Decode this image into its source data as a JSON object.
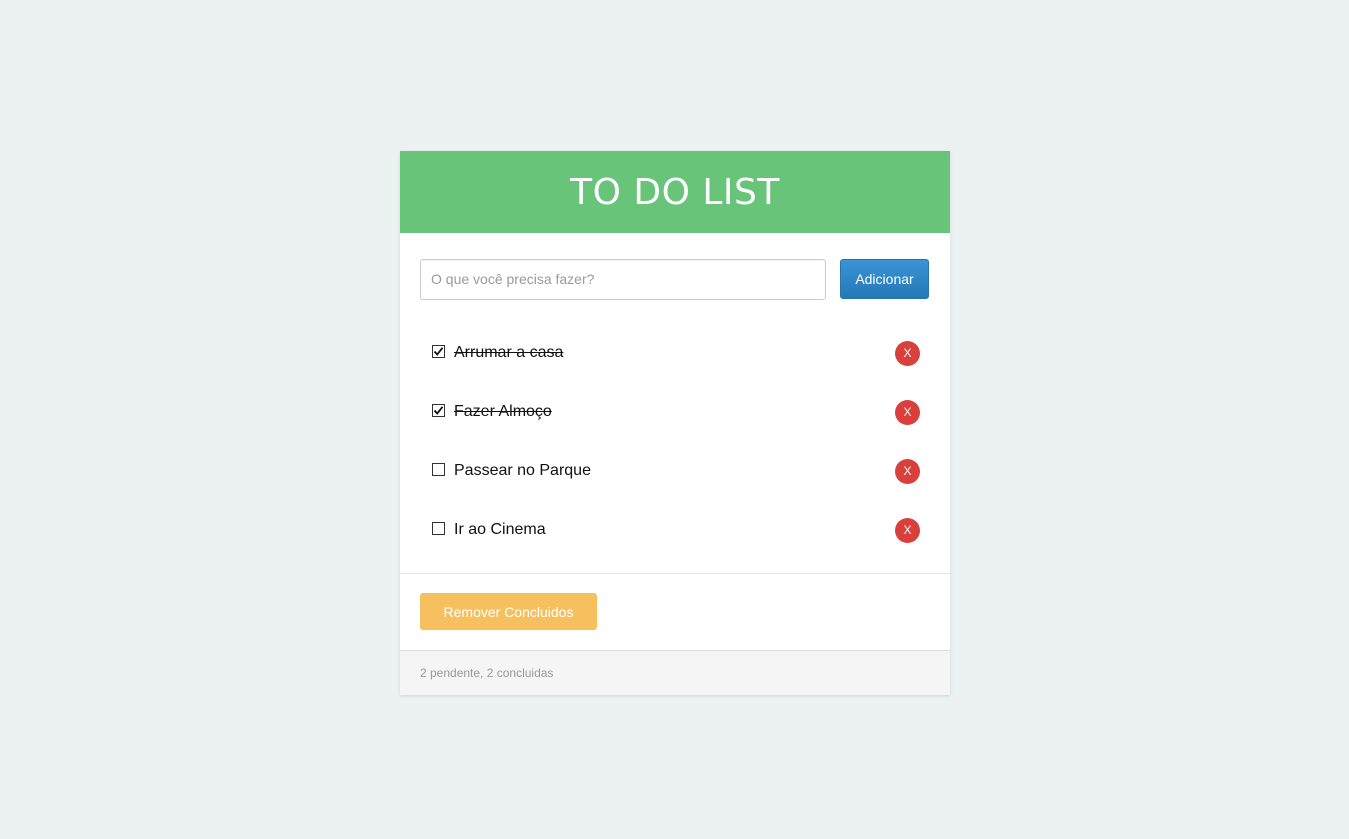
{
  "header": {
    "title": "TO DO LIST"
  },
  "add_form": {
    "placeholder": "O que você precisa fazer?",
    "value": "",
    "button_label": "Adicionar"
  },
  "tasks": [
    {
      "text": "Arrumar a casa",
      "done": true,
      "delete_label": "X"
    },
    {
      "text": "Fazer Almoço",
      "done": true,
      "delete_label": "X"
    },
    {
      "text": "Passear no Parque",
      "done": false,
      "delete_label": "X"
    },
    {
      "text": "Ir ao Cinema",
      "done": false,
      "delete_label": "X"
    }
  ],
  "actions": {
    "remove_done_label": "Remover Concluidos"
  },
  "footer": {
    "status": "2 pendente, 2 concluidas"
  },
  "colors": {
    "background": "#ecf1f1",
    "header": "#67c478",
    "add_button": "#2a85c8",
    "delete_button": "#d9403c",
    "remove_done_button": "#f7c05e",
    "footer": "#f5f5f5"
  }
}
